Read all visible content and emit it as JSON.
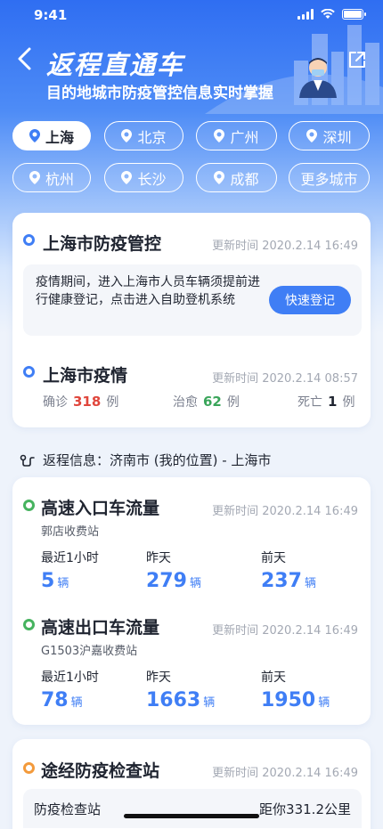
{
  "status_bar": {
    "time": "9:41"
  },
  "header": {
    "title": "返程直通车",
    "subtitle": "目的地城市防疫管控信息实时掌握"
  },
  "cities": [
    {
      "label": "上海",
      "active": true
    },
    {
      "label": "北京",
      "active": false
    },
    {
      "label": "广州",
      "active": false
    },
    {
      "label": "深圳",
      "active": false
    },
    {
      "label": "杭州",
      "active": false
    },
    {
      "label": "长沙",
      "active": false
    },
    {
      "label": "成都",
      "active": false
    }
  ],
  "more_cities_label": "更多城市",
  "control": {
    "title": "上海市防疫管控",
    "updated": "更新时间 2020.2.14 16:49",
    "notice": "疫情期间，进入上海市人员车辆须提前进行健康登记，点击进入自助登机系统",
    "register_button": "快速登记"
  },
  "epidemic": {
    "title": "上海市疫情",
    "updated": "更新时间 2020.2.14 08:57",
    "confirmed_label": "确诊",
    "confirmed_value": "318",
    "confirmed_unit": "例",
    "cured_label": "治愈",
    "cured_value": "62",
    "cured_unit": "例",
    "death_label": "死亡",
    "death_value": "1",
    "death_unit": "例"
  },
  "route": {
    "text": "返程信息：济南市 (我的位置) - 上海市"
  },
  "traffic": {
    "entry": {
      "title": "高速入口车流量",
      "updated": "更新时间 2020.2.14 16:49",
      "station": "郭店收费站",
      "cols": [
        {
          "label": "最近1小时",
          "value": "5",
          "unit": "辆"
        },
        {
          "label": "昨天",
          "value": "279",
          "unit": "辆"
        },
        {
          "label": "前天",
          "value": "237",
          "unit": "辆"
        }
      ]
    },
    "exit": {
      "title": "高速出口车流量",
      "updated": "更新时间 2020.2.14 16:49",
      "station": "G1503沪嘉收费站",
      "cols": [
        {
          "label": "最近1小时",
          "value": "78",
          "unit": "辆"
        },
        {
          "label": "昨天",
          "value": "1663",
          "unit": "辆"
        },
        {
          "label": "前天",
          "value": "1950",
          "unit": "辆"
        }
      ]
    }
  },
  "checkpoints": {
    "title": "途经防疫检查站",
    "updated": "更新时间 2020.2.14 16:49",
    "row_name": "防疫检查站",
    "row_distance": "距你331.2公里"
  },
  "colors": {
    "primary": "#3f7ef5",
    "green": "#46b35f",
    "orange": "#f39a3b",
    "red": "#e0463c"
  }
}
